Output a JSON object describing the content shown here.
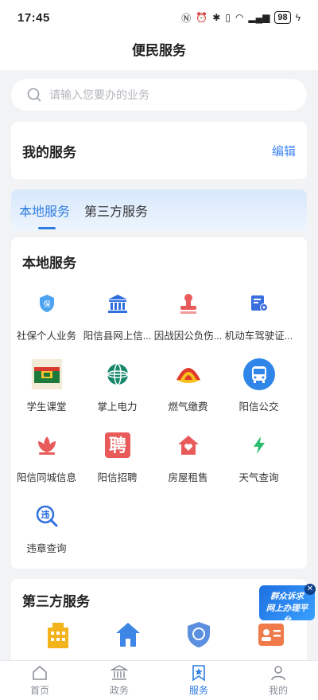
{
  "status": {
    "time": "17:45",
    "battery": "98"
  },
  "header": {
    "title": "便民服务"
  },
  "search": {
    "placeholder": "请输入您要办的业务"
  },
  "my_services": {
    "title": "我的服务",
    "edit": "编辑"
  },
  "tabs": [
    {
      "label": "本地服务"
    },
    {
      "label": "第三方服务"
    }
  ],
  "local": {
    "title": "本地服务",
    "items": [
      {
        "label": "社保个人业务",
        "icon": "social-security-icon"
      },
      {
        "label": "阳信县网上信...",
        "icon": "government-building-icon"
      },
      {
        "label": "因战因公负伤...",
        "icon": "stamp-icon"
      },
      {
        "label": "机动车驾驶证...",
        "icon": "license-card-icon"
      },
      {
        "label": "学生课堂",
        "icon": "classroom-icon"
      },
      {
        "label": "掌上电力",
        "icon": "state-grid-icon"
      },
      {
        "label": "燃气缴费",
        "icon": "petrochina-icon"
      },
      {
        "label": "阳信公交",
        "icon": "bus-icon"
      },
      {
        "label": "阳信同城信息",
        "icon": "lotus-icon"
      },
      {
        "label": "阳信招聘",
        "icon": "recruit-icon",
        "glyph": "聘"
      },
      {
        "label": "房屋租售",
        "icon": "house-heart-icon"
      },
      {
        "label": "天气查询",
        "icon": "lightning-icon"
      },
      {
        "label": "违章查询",
        "icon": "violation-search-icon",
        "glyph": "违"
      }
    ]
  },
  "third": {
    "title": "第三方服务"
  },
  "float_ad": {
    "line1": "群众诉求",
    "line2": "网上办理平台"
  },
  "tabbar": [
    {
      "label": "首页",
      "icon": "home-icon"
    },
    {
      "label": "政务",
      "icon": "government-icon"
    },
    {
      "label": "服务",
      "icon": "service-star-icon",
      "active": true
    },
    {
      "label": "我的",
      "icon": "profile-icon"
    }
  ],
  "colors": {
    "accent": "#2f7de1",
    "red": "#e95a5a",
    "green": "#2dbd6e"
  }
}
